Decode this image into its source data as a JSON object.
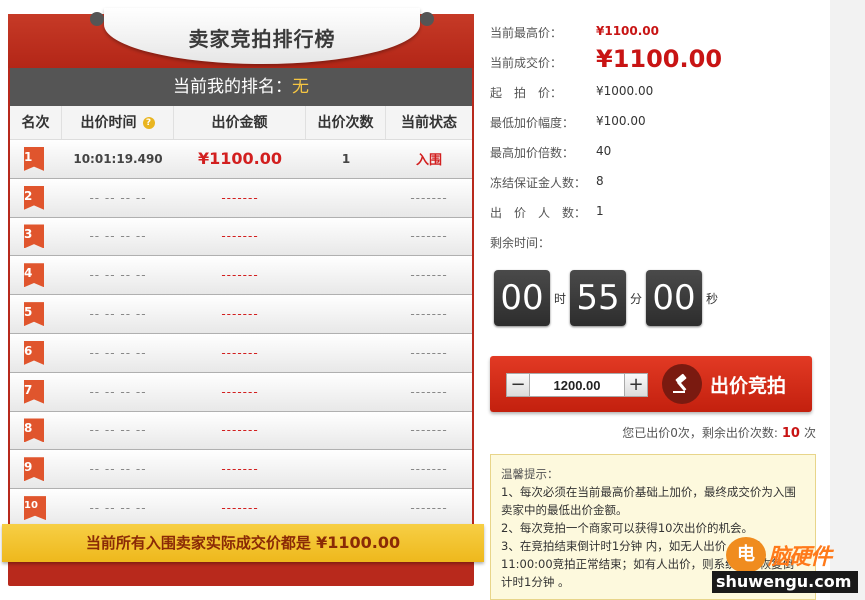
{
  "ranking": {
    "title": "卖家竞拍排行榜",
    "my_rank_label": "当前我的排名：",
    "my_rank_value": "无",
    "columns": [
      "名次",
      "出价时间",
      "出价金额",
      "出价次数",
      "当前状态"
    ],
    "rows": [
      {
        "rank": "1",
        "time": "10:01:19.490",
        "amount": "¥1100.00",
        "count": "1",
        "status": "入围"
      },
      {
        "rank": "2",
        "time": "-- -- -- --",
        "amount": "-------",
        "count": "",
        "status": "-------"
      },
      {
        "rank": "3",
        "time": "-- -- -- --",
        "amount": "-------",
        "count": "",
        "status": "-------"
      },
      {
        "rank": "4",
        "time": "-- -- -- --",
        "amount": "-------",
        "count": "",
        "status": "-------"
      },
      {
        "rank": "5",
        "time": "-- -- -- --",
        "amount": "-------",
        "count": "",
        "status": "-------"
      },
      {
        "rank": "6",
        "time": "-- -- -- --",
        "amount": "-------",
        "count": "",
        "status": "-------"
      },
      {
        "rank": "7",
        "time": "-- -- -- --",
        "amount": "-------",
        "count": "",
        "status": "-------"
      },
      {
        "rank": "8",
        "time": "-- -- -- --",
        "amount": "-------",
        "count": "",
        "status": "-------"
      },
      {
        "rank": "9",
        "time": "-- -- -- --",
        "amount": "-------",
        "count": "",
        "status": "-------"
      },
      {
        "rank": "10",
        "time": "-- -- -- --",
        "amount": "-------",
        "count": "",
        "status": "-------"
      }
    ],
    "footer_text": "当前所有入围卖家实际成交价都是",
    "footer_price": "¥1100.00"
  },
  "auction": {
    "highest_label": "当前最高价：",
    "highest_value": "¥1100.00",
    "deal_label": "当前成交价：",
    "deal_value": "¥1100.00",
    "start_label": "起　拍　价：",
    "start_value": "¥1000.00",
    "min_inc_label": "最低加价幅度：",
    "min_inc_value": "¥100.00",
    "max_mult_label": "最高加价倍数：",
    "max_mult_value": "40",
    "frozen_label": "冻结保证金人数：",
    "frozen_value": "8",
    "bidders_label": "出　价　人　数：",
    "bidders_value": "1",
    "remaining_label": "剩余时间："
  },
  "timer": {
    "hours": "00",
    "h_unit": "时",
    "minutes": "55",
    "m_unit": "分",
    "seconds": "00",
    "s_unit": "秒"
  },
  "bid": {
    "minus": "−",
    "plus": "+",
    "amount": "1200.00",
    "button_label": "出价竞拍",
    "info_prefix": "您已出价0次，剩余出价次数:",
    "info_remaining": "10",
    "info_suffix": "次"
  },
  "tips": {
    "title": "温馨提示：",
    "items": [
      "1、每次必须在当前最高价基础上加价，最终成交价为入围卖家中的最低出价金额。",
      "2、每次竞拍一个商家可以获得10次出价的机会。",
      "3、在竞拍结束倒计时1分钟 内，如无人出价，则于　　11:00:00竞拍正常结束；如有人出价，则系统自动恢复倒计时1分钟 。"
    ]
  },
  "watermark": {
    "badge": "电",
    "cn": "脑硬件",
    "en": "shuwengu.com"
  },
  "colors": {
    "brand_red": "#c3200e",
    "price_red": "#c81414",
    "gold": "#eeb81c"
  }
}
